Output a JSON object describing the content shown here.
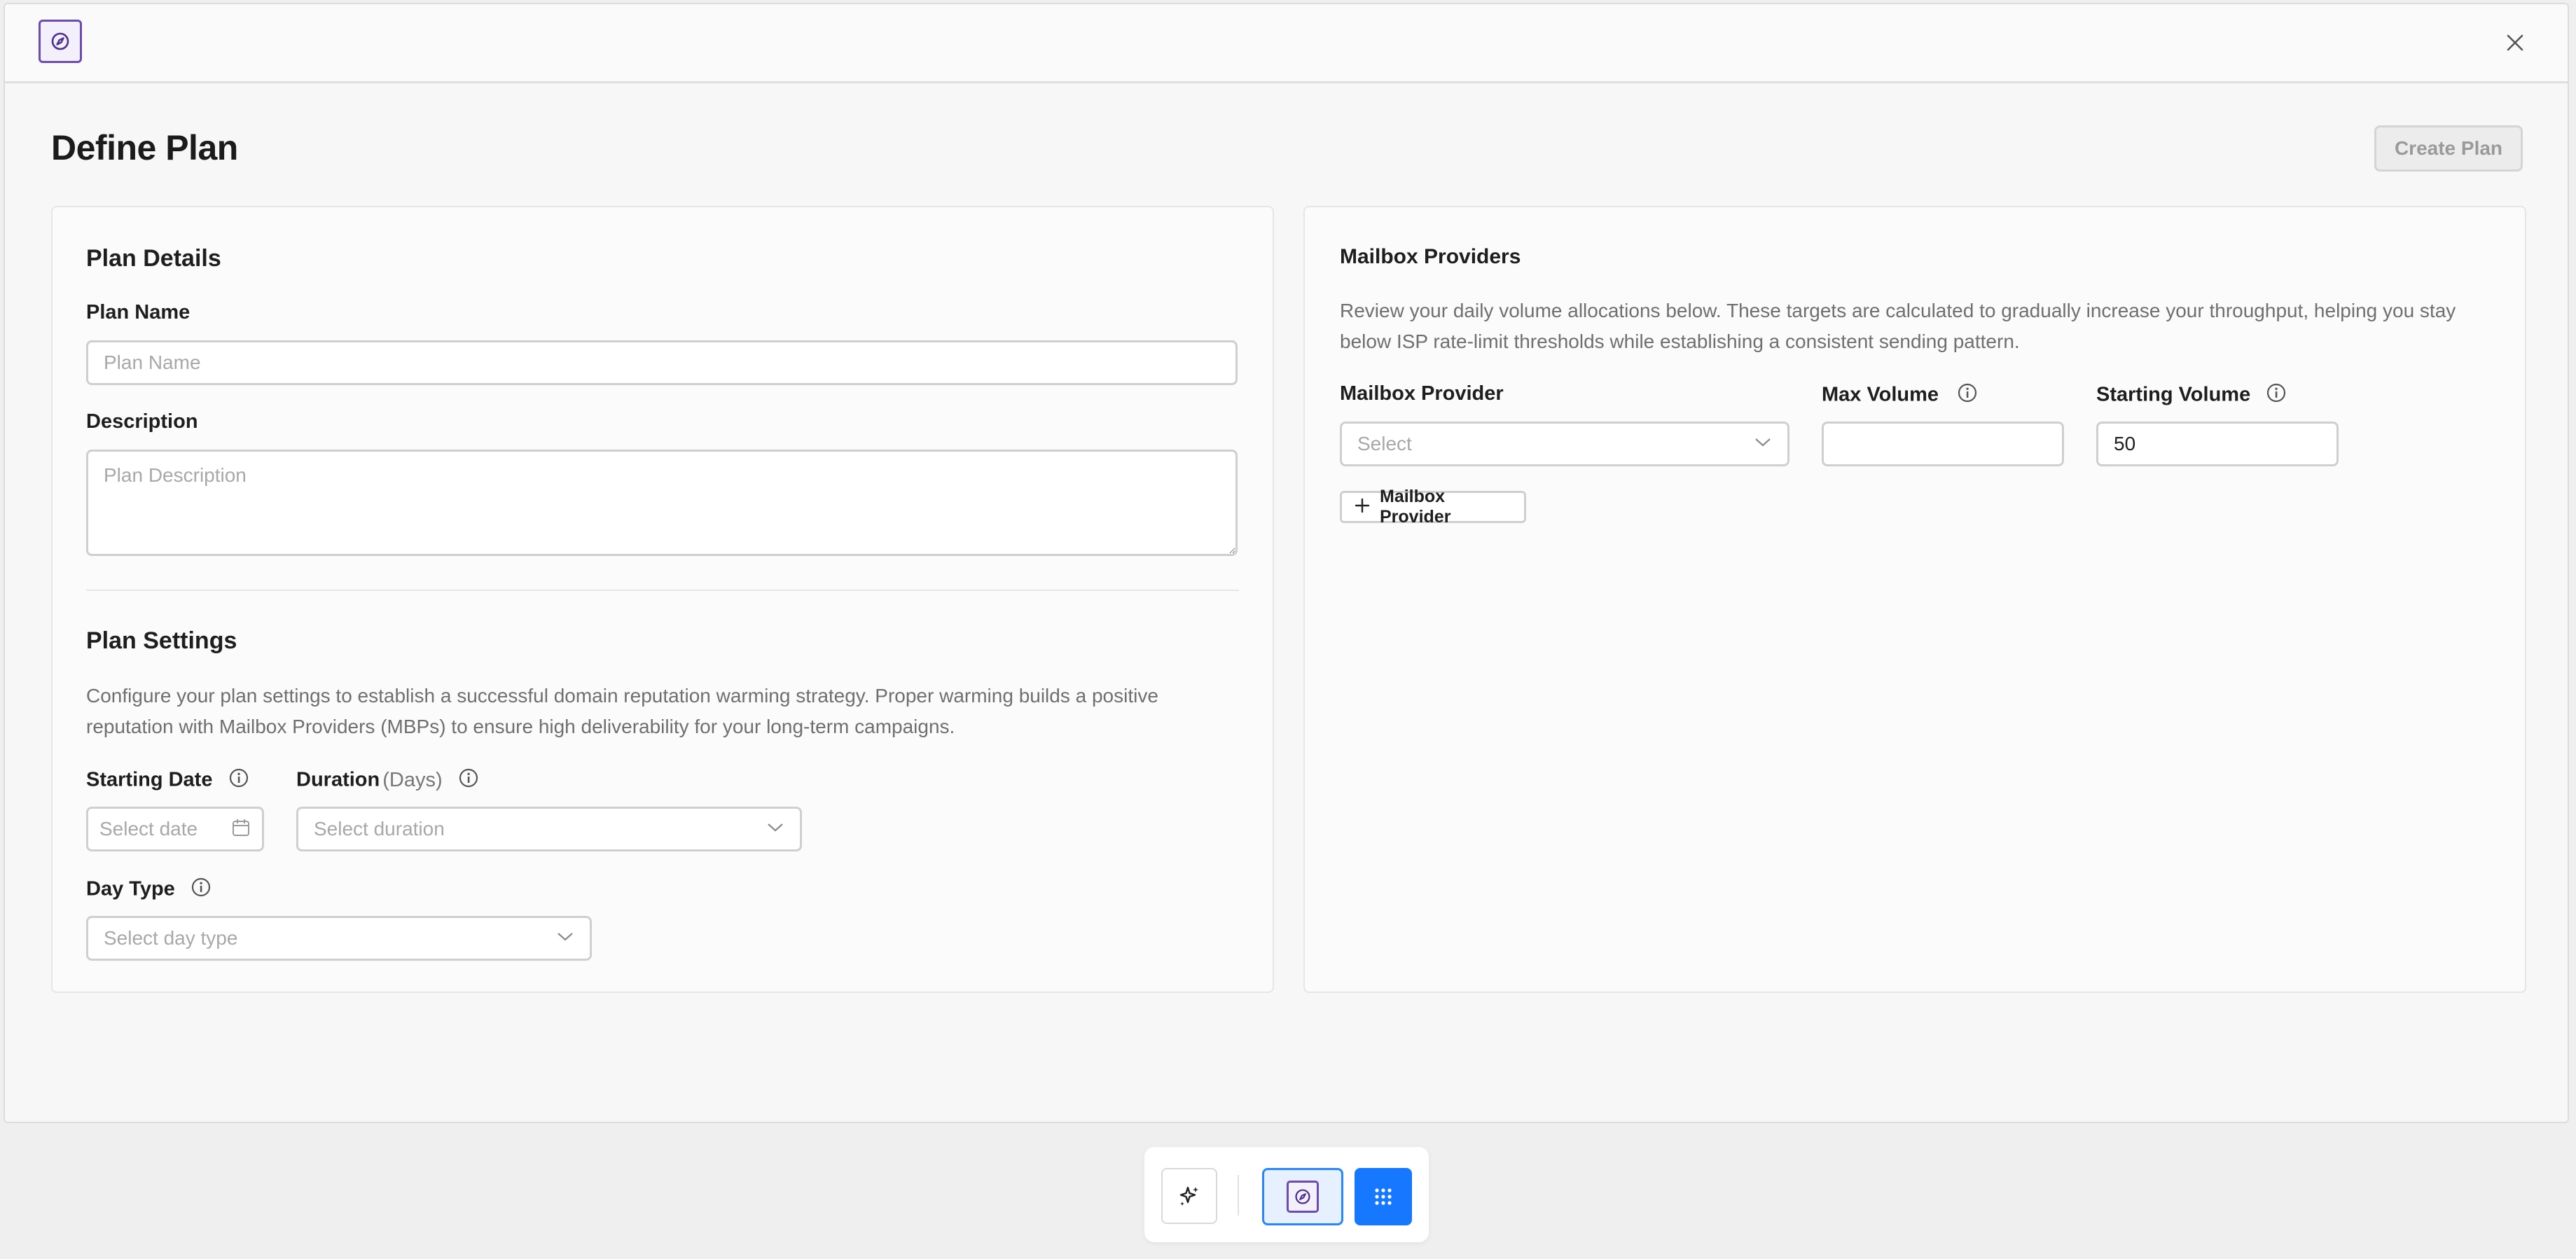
{
  "header": {
    "page_title": "Define Plan",
    "create_button": "Create Plan"
  },
  "plan_details": {
    "title": "Plan Details",
    "name_label": "Plan Name",
    "name_placeholder": "Plan Name",
    "name_value": "",
    "description_label": "Description",
    "description_placeholder": "Plan Description",
    "description_value": ""
  },
  "plan_settings": {
    "title": "Plan Settings",
    "description": "Configure your plan settings to establish a successful domain reputation warming strategy. Proper warming builds a positive reputation with Mailbox Providers (MBPs) to ensure high deliverability for your long-term campaigns.",
    "starting_date_label": "Starting Date",
    "starting_date_placeholder": "Select date",
    "duration_label": "Duration",
    "duration_unit": "(Days)",
    "duration_placeholder": "Select duration",
    "day_type_label": "Day Type",
    "day_type_placeholder": "Select day type"
  },
  "mailbox_providers": {
    "title": "Mailbox Providers",
    "description": "Review your daily volume allocations below. These targets are calculated to gradually increase your throughput, helping you stay below ISP rate-limit thresholds while establishing a consistent sending pattern.",
    "provider_label": "Mailbox Provider",
    "provider_placeholder": "Select",
    "max_volume_label": "Max Volume",
    "max_volume_value": "",
    "starting_volume_label": "Starting Volume",
    "starting_volume_value": "50",
    "add_button": "Mailbox Provider"
  },
  "colors": {
    "accent_purple": "#6c4bb4",
    "accent_blue": "#1677ff",
    "background": "#efefef"
  },
  "dock": {
    "items": [
      "sparkle-icon",
      "compass-app-icon",
      "apps-grid-icon"
    ]
  }
}
